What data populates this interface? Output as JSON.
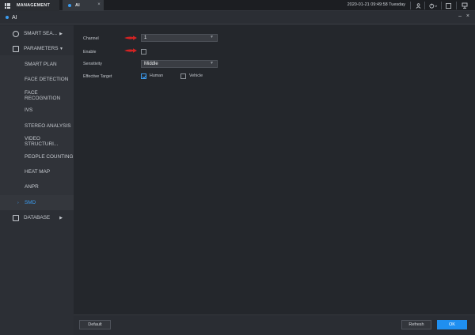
{
  "topbar": {
    "management_label": "MANAGEMENT",
    "active_tab_label": "AI",
    "tab_close": "×",
    "datetime": "2020-01-21 09:49:58 Tuesday"
  },
  "window": {
    "title": "AI",
    "controls": "– ×"
  },
  "sidebar": {
    "groups": [
      {
        "label": "SMART SEA...",
        "icon": "smart-search-icon"
      },
      {
        "label": "PARAMETERS",
        "icon": "list-icon"
      },
      {
        "label": "DATABASE",
        "icon": "database-icon"
      }
    ],
    "items": [
      {
        "label": "SMART PLAN"
      },
      {
        "label": "FACE DETECTION"
      },
      {
        "label": "FACE RECOGNITION"
      },
      {
        "label": "IVS"
      },
      {
        "label": "STEREO ANALYSIS"
      },
      {
        "label": "VIDEO STRUCTURI..."
      },
      {
        "label": "PEOPLE COUNTING"
      },
      {
        "label": "HEAT MAP"
      },
      {
        "label": "ANPR"
      },
      {
        "label": "SMD"
      }
    ],
    "active_item": "SMD"
  },
  "form": {
    "channel_label": "Channel",
    "channel_value": "1",
    "enable_label": "Enable",
    "enable_checked": false,
    "sensitivity_label": "Sensitivity",
    "sensitivity_value": "Middle",
    "target_label": "Effective Target",
    "target_human_label": "Human",
    "target_human_checked": true,
    "target_vehicle_label": "Vehicle",
    "target_vehicle_checked": false
  },
  "footer": {
    "default_label": "Default",
    "refresh_label": "Refresh",
    "ok_label": "OK"
  },
  "colors": {
    "accent": "#1f8ff0",
    "annotation_arrow": "#d42323"
  }
}
